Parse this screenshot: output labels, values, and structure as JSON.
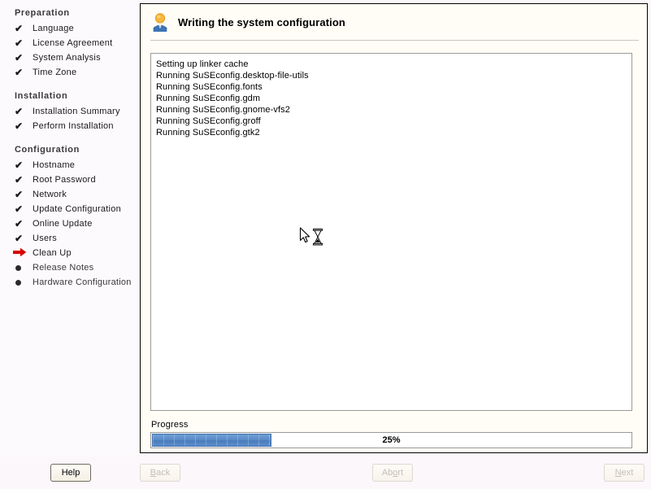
{
  "sidebar": {
    "sections": [
      {
        "heading": "Preparation",
        "items": [
          {
            "label": "Language",
            "state": "done"
          },
          {
            "label": "License Agreement",
            "state": "done"
          },
          {
            "label": "System Analysis",
            "state": "done"
          },
          {
            "label": "Time Zone",
            "state": "done"
          }
        ]
      },
      {
        "heading": "Installation",
        "items": [
          {
            "label": "Installation Summary",
            "state": "done"
          },
          {
            "label": "Perform Installation",
            "state": "done"
          }
        ]
      },
      {
        "heading": "Configuration",
        "items": [
          {
            "label": "Hostname",
            "state": "done"
          },
          {
            "label": "Root Password",
            "state": "done"
          },
          {
            "label": "Network",
            "state": "done"
          },
          {
            "label": "Update Configuration",
            "state": "done"
          },
          {
            "label": "Online Update",
            "state": "done"
          },
          {
            "label": "Users",
            "state": "done"
          },
          {
            "label": "Clean Up",
            "state": "current"
          },
          {
            "label": "Release Notes",
            "state": "pending"
          },
          {
            "label": "Hardware Configuration",
            "state": "pending"
          }
        ]
      }
    ]
  },
  "panel": {
    "icon": "person-icon",
    "title": "Writing the system configuration",
    "log_lines": [
      "Setting up linker cache",
      "Running SuSEconfig.desktop-file-utils",
      "Running SuSEconfig.fonts",
      "Running SuSEconfig.gdm",
      "Running SuSEconfig.gnome-vfs2",
      "Running SuSEconfig.groff",
      "Running SuSEconfig.gtk2"
    ],
    "progress": {
      "label": "Progress",
      "percent": 25,
      "percent_text": "25%"
    }
  },
  "buttons": {
    "help": {
      "label": "Help",
      "mnemonic": "",
      "enabled": true
    },
    "back": {
      "label": "Back",
      "mnemonic": "B",
      "enabled": false
    },
    "abort": {
      "label": "Abort",
      "mnemonic": "o",
      "enabled": false
    },
    "next": {
      "label": "Next",
      "mnemonic": "N",
      "enabled": false
    }
  },
  "cursor": {
    "name": "busy-pointer-cursor"
  },
  "colors": {
    "sidebar_bg": "#fdfafd",
    "panel_bg": "#fffdf6",
    "window_bg": "#fbf7fb",
    "progress_fill": "#5b8cc8",
    "current_step_arrow": "#d80000",
    "log_bg": "#ffffff"
  }
}
